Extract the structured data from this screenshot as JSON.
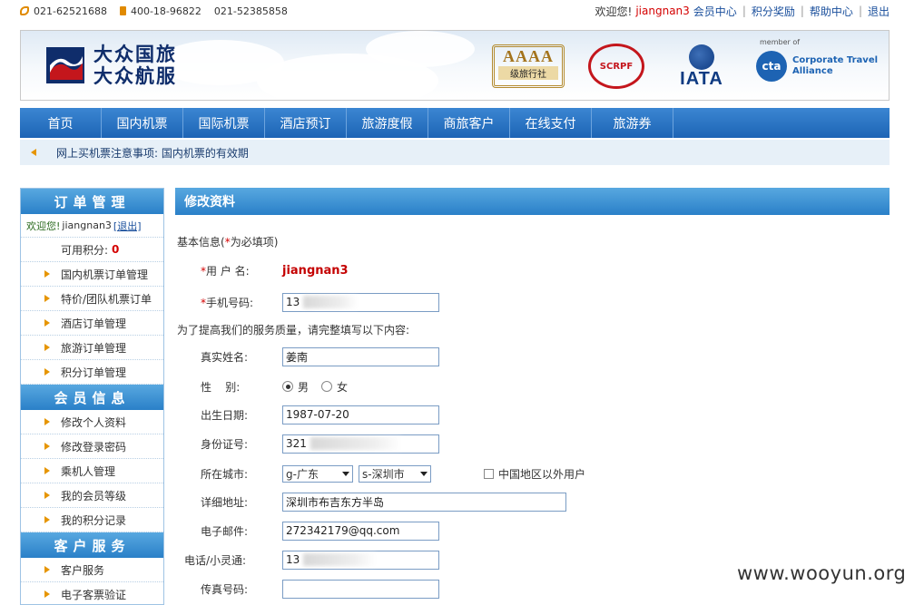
{
  "topbar": {
    "phone1": "021-62521688",
    "phone2": "400-18-96822",
    "phone3": "021-52385858",
    "welcome": "欢迎您!",
    "username": "jiangnan3",
    "links": [
      "会员中心",
      "积分奖励",
      "帮助中心",
      "退出"
    ]
  },
  "banner": {
    "logo_line1": "大众国旅",
    "logo_line2": "大众航服",
    "aaaa": "AAAA",
    "aaaa_sub": "级旅行社",
    "scrpf": "SCRPF",
    "iata": "IATA",
    "cta_mark": "cta",
    "cta_member": "member of",
    "cta_line1": "Corporate Travel",
    "cta_line2": "Alliance"
  },
  "nav": [
    "首页",
    "国内机票",
    "国际机票",
    "酒店预订",
    "旅游度假",
    "商旅客户",
    "在线支付",
    "旅游券"
  ],
  "notice": "网上买机票注意事项: 国内机票的有效期",
  "sidebar": {
    "order_title": "订单管理",
    "welcome": "欢迎您!",
    "username": "jiangnan3",
    "logout": "[退出]",
    "points_label": "可用积分:",
    "points_value": "0",
    "order_items": [
      "国内机票订单管理",
      "特价/团队机票订单",
      "酒店订单管理",
      "旅游订单管理",
      "积分订单管理"
    ],
    "member_title": "会员信息",
    "member_items": [
      "修改个人资料",
      "修改登录密码",
      "乘机人管理",
      "我的会员等级",
      "我的积分记录"
    ],
    "service_title": "客户服务",
    "service_items": [
      "客户服务",
      "电子客票验证"
    ]
  },
  "main": {
    "title": "修改资料",
    "basic_info": "基本信息(",
    "required_note": "为必填项)",
    "username_label": "用 户 名:",
    "username_value": "jiangnan3",
    "mobile_label": "手机号码:",
    "mobile_value": "13",
    "improve_note": "为了提高我们的服务质量，请完整填写以下内容:",
    "realname_label": "真实姓名:",
    "realname_value": "姜南",
    "gender_label": "性    别:",
    "gender_male": "男",
    "gender_female": "女",
    "birth_label": "出生日期:",
    "birth_value": "1987-07-20",
    "id_label": "身份证号:",
    "id_value": "321",
    "city_label": "所在城市:",
    "province_value": "g-广东",
    "city_value": "s-深圳市",
    "overseas_label": "中国地区以外用户",
    "address_label": "详细地址:",
    "address_value": "深圳市布吉东方半岛",
    "email_label": "电子邮件:",
    "email_value": "272342179@qq.com",
    "phone_label": "电话/小灵通:",
    "phone_value": "13",
    "fax_label": "传真号码:",
    "fax_value": ""
  },
  "watermark": "www.wooyun.org"
}
